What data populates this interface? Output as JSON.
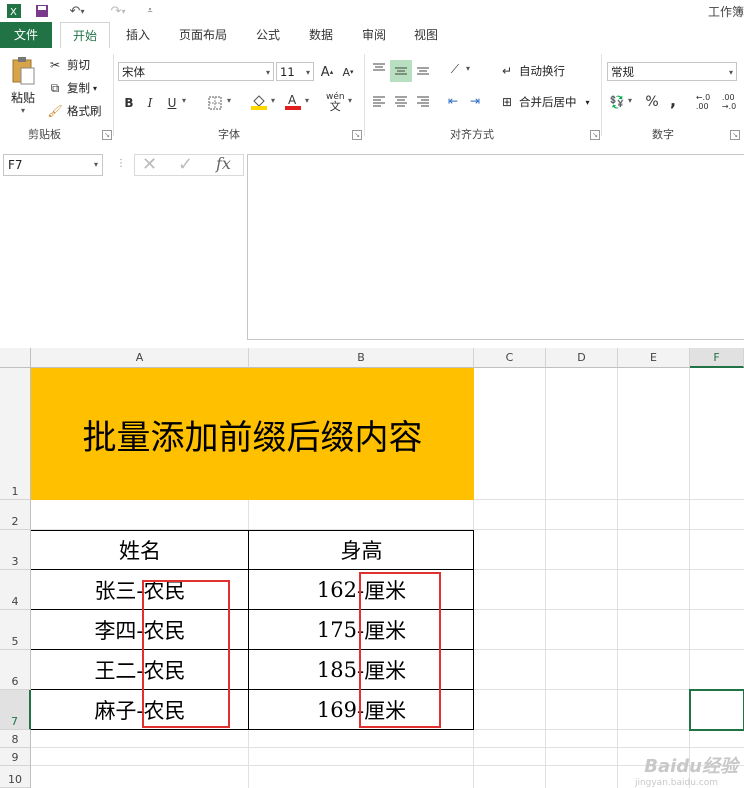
{
  "app": {
    "window_title": "工作簿"
  },
  "ribbon_tabs": [
    "文件",
    "开始",
    "插入",
    "页面布局",
    "公式",
    "数据",
    "审阅",
    "视图"
  ],
  "clipboard": {
    "paste": "粘贴",
    "cut": "剪切",
    "copy": "复制",
    "format_painter": "格式刷",
    "group_label": "剪贴板"
  },
  "font": {
    "name": "宋体",
    "size": "11",
    "bold": "B",
    "italic": "I",
    "underline": "U",
    "phonetic": "wén",
    "group_label": "字体"
  },
  "alignment": {
    "wrap_text": "自动换行",
    "merge_center": "合并后居中",
    "group_label": "对齐方式"
  },
  "number": {
    "format": "常规",
    "percent": "%",
    "comma": ",",
    "group_label": "数字"
  },
  "formula_bar": {
    "name_box": "F7",
    "fx": "fx",
    "content": ""
  },
  "columns": [
    "A",
    "B",
    "C",
    "D",
    "E",
    "F"
  ],
  "rows": [
    "1",
    "2",
    "3",
    "4",
    "5",
    "6",
    "7",
    "8",
    "9",
    "10"
  ],
  "sheet": {
    "title": "批量添加前缀后缀内容",
    "header_name": "姓名",
    "header_height": "身高",
    "records": [
      {
        "name_prefix": "张三",
        "name_suffix": "-农民",
        "height_prefix": "162",
        "height_suffix": "-厘米"
      },
      {
        "name_prefix": "李四",
        "name_suffix": "-农民",
        "height_prefix": "175",
        "height_suffix": "-厘米"
      },
      {
        "name_prefix": "王二",
        "name_suffix": "-农民",
        "height_prefix": "185",
        "height_suffix": "-厘米"
      },
      {
        "name_prefix": "麻子",
        "name_suffix": "-农民",
        "height_prefix": "169",
        "height_suffix": "-厘米"
      }
    ]
  },
  "watermark": {
    "logo": "Baidu经验",
    "url": "jingyan.baidu.com"
  },
  "colors": {
    "excel_green": "#217346",
    "title_fill": "#FFC000",
    "highlight_red": "#E03030"
  }
}
